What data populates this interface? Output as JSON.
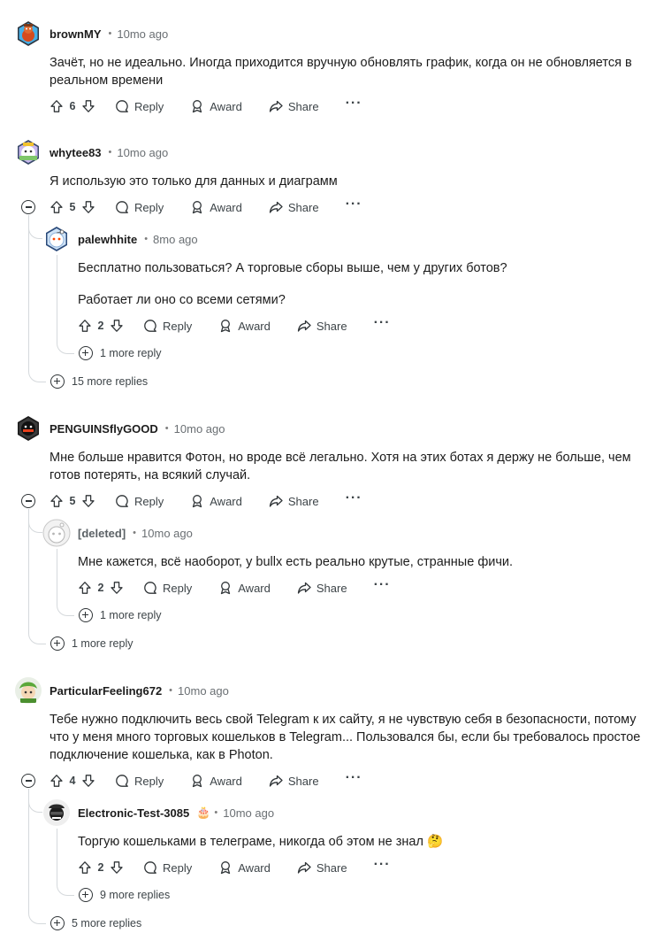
{
  "comments": [
    {
      "username": "brownMY",
      "time": "10mo ago",
      "body": [
        "Зачёт, но не идеально. Иногда приходится вручную обновлять график, когда он не обновляется в реальном времени"
      ],
      "votes": "6"
    },
    {
      "username": "whytee83",
      "time": "10mo ago",
      "body": [
        "Я использую это только для данных и диаграмм"
      ],
      "votes": "5",
      "more_replies": "15 more replies"
    },
    {
      "username": "palewhhite",
      "time": "8mo ago",
      "body": [
        "Бесплатно пользоваться? А торговые сборы выше, чем у других ботов?",
        "Работает ли оно со всеми сетями?"
      ],
      "votes": "2",
      "more_replies": "1 more reply"
    },
    {
      "username": "PENGUINSflyGOOD",
      "time": "10mo ago",
      "body": [
        "Мне больше нравится Фотон, но вроде всё легально. Хотя на этих ботах я держу не больше, чем готов потерять, на всякий случай."
      ],
      "votes": "5",
      "more_replies": "1 more reply"
    },
    {
      "username": "[deleted]",
      "time": "10mo ago",
      "body": [
        "Мне кажется, всё наоборот, у bullx есть реально крутые, странные фичи."
      ],
      "votes": "2",
      "more_replies": "1 more reply"
    },
    {
      "username": "ParticularFeeling672",
      "time": "10mo ago",
      "body": [
        "Тебе нужно подключить весь свой Telegram к их сайту, я не чувствую себя в безопасности, потому что у меня много торговых кошельков в Telegram... Пользовался бы, если бы требовалось простое подключение кошелька, как в Photon."
      ],
      "votes": "4",
      "more_replies": "5 more replies"
    },
    {
      "username": "Electronic-Test-3085",
      "flair": "🎂",
      "time": "10mo ago",
      "body": [
        "Торгую кошельками в телеграме, никогда об этом не знал 🤔"
      ],
      "votes": "2",
      "more_replies": "9 more replies"
    }
  ],
  "actions": {
    "reply": "Reply",
    "award": "Award",
    "share": "Share",
    "more": "···",
    "separator": "•"
  },
  "icons": [
    "upvote-icon",
    "downvote-icon",
    "comment-icon",
    "award-icon",
    "share-icon",
    "collapse-icon",
    "expand-icon"
  ]
}
